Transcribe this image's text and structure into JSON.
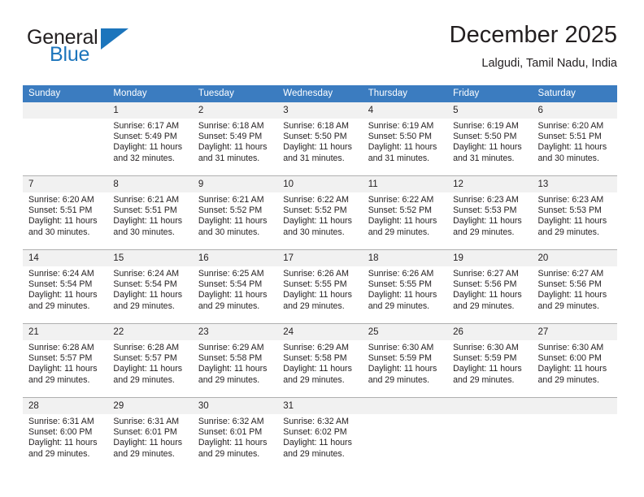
{
  "brand": {
    "name_part1": "General",
    "name_part2": "Blue",
    "flag_icon": "triangle-flag-icon"
  },
  "header": {
    "title": "December 2025",
    "subtitle": "Lalgudi, Tamil Nadu, India"
  },
  "colors": {
    "header_bar": "#3b7cc0",
    "brand_blue": "#1c75bc",
    "day_number_bg": "#f1f1f1",
    "row_divider": "#b0b0b0",
    "text": "#231f20"
  },
  "labels": {
    "sunrise_prefix": "Sunrise:",
    "sunset_prefix": "Sunset:",
    "daylight_prefix": "Daylight:"
  },
  "weekday_headers": [
    "Sunday",
    "Monday",
    "Tuesday",
    "Wednesday",
    "Thursday",
    "Friday",
    "Saturday"
  ],
  "weeks": [
    [
      {
        "day": "",
        "empty": true
      },
      {
        "day": "1",
        "sunrise": "Sunrise: 6:17 AM",
        "sunset": "Sunset: 5:49 PM",
        "daylight_line1": "Daylight: 11 hours",
        "daylight_line2": "and 32 minutes."
      },
      {
        "day": "2",
        "sunrise": "Sunrise: 6:18 AM",
        "sunset": "Sunset: 5:49 PM",
        "daylight_line1": "Daylight: 11 hours",
        "daylight_line2": "and 31 minutes."
      },
      {
        "day": "3",
        "sunrise": "Sunrise: 6:18 AM",
        "sunset": "Sunset: 5:50 PM",
        "daylight_line1": "Daylight: 11 hours",
        "daylight_line2": "and 31 minutes."
      },
      {
        "day": "4",
        "sunrise": "Sunrise: 6:19 AM",
        "sunset": "Sunset: 5:50 PM",
        "daylight_line1": "Daylight: 11 hours",
        "daylight_line2": "and 31 minutes."
      },
      {
        "day": "5",
        "sunrise": "Sunrise: 6:19 AM",
        "sunset": "Sunset: 5:50 PM",
        "daylight_line1": "Daylight: 11 hours",
        "daylight_line2": "and 31 minutes."
      },
      {
        "day": "6",
        "sunrise": "Sunrise: 6:20 AM",
        "sunset": "Sunset: 5:51 PM",
        "daylight_line1": "Daylight: 11 hours",
        "daylight_line2": "and 30 minutes."
      }
    ],
    [
      {
        "day": "7",
        "sunrise": "Sunrise: 6:20 AM",
        "sunset": "Sunset: 5:51 PM",
        "daylight_line1": "Daylight: 11 hours",
        "daylight_line2": "and 30 minutes."
      },
      {
        "day": "8",
        "sunrise": "Sunrise: 6:21 AM",
        "sunset": "Sunset: 5:51 PM",
        "daylight_line1": "Daylight: 11 hours",
        "daylight_line2": "and 30 minutes."
      },
      {
        "day": "9",
        "sunrise": "Sunrise: 6:21 AM",
        "sunset": "Sunset: 5:52 PM",
        "daylight_line1": "Daylight: 11 hours",
        "daylight_line2": "and 30 minutes."
      },
      {
        "day": "10",
        "sunrise": "Sunrise: 6:22 AM",
        "sunset": "Sunset: 5:52 PM",
        "daylight_line1": "Daylight: 11 hours",
        "daylight_line2": "and 30 minutes."
      },
      {
        "day": "11",
        "sunrise": "Sunrise: 6:22 AM",
        "sunset": "Sunset: 5:52 PM",
        "daylight_line1": "Daylight: 11 hours",
        "daylight_line2": "and 29 minutes."
      },
      {
        "day": "12",
        "sunrise": "Sunrise: 6:23 AM",
        "sunset": "Sunset: 5:53 PM",
        "daylight_line1": "Daylight: 11 hours",
        "daylight_line2": "and 29 minutes."
      },
      {
        "day": "13",
        "sunrise": "Sunrise: 6:23 AM",
        "sunset": "Sunset: 5:53 PM",
        "daylight_line1": "Daylight: 11 hours",
        "daylight_line2": "and 29 minutes."
      }
    ],
    [
      {
        "day": "14",
        "sunrise": "Sunrise: 6:24 AM",
        "sunset": "Sunset: 5:54 PM",
        "daylight_line1": "Daylight: 11 hours",
        "daylight_line2": "and 29 minutes."
      },
      {
        "day": "15",
        "sunrise": "Sunrise: 6:24 AM",
        "sunset": "Sunset: 5:54 PM",
        "daylight_line1": "Daylight: 11 hours",
        "daylight_line2": "and 29 minutes."
      },
      {
        "day": "16",
        "sunrise": "Sunrise: 6:25 AM",
        "sunset": "Sunset: 5:54 PM",
        "daylight_line1": "Daylight: 11 hours",
        "daylight_line2": "and 29 minutes."
      },
      {
        "day": "17",
        "sunrise": "Sunrise: 6:26 AM",
        "sunset": "Sunset: 5:55 PM",
        "daylight_line1": "Daylight: 11 hours",
        "daylight_line2": "and 29 minutes."
      },
      {
        "day": "18",
        "sunrise": "Sunrise: 6:26 AM",
        "sunset": "Sunset: 5:55 PM",
        "daylight_line1": "Daylight: 11 hours",
        "daylight_line2": "and 29 minutes."
      },
      {
        "day": "19",
        "sunrise": "Sunrise: 6:27 AM",
        "sunset": "Sunset: 5:56 PM",
        "daylight_line1": "Daylight: 11 hours",
        "daylight_line2": "and 29 minutes."
      },
      {
        "day": "20",
        "sunrise": "Sunrise: 6:27 AM",
        "sunset": "Sunset: 5:56 PM",
        "daylight_line1": "Daylight: 11 hours",
        "daylight_line2": "and 29 minutes."
      }
    ],
    [
      {
        "day": "21",
        "sunrise": "Sunrise: 6:28 AM",
        "sunset": "Sunset: 5:57 PM",
        "daylight_line1": "Daylight: 11 hours",
        "daylight_line2": "and 29 minutes."
      },
      {
        "day": "22",
        "sunrise": "Sunrise: 6:28 AM",
        "sunset": "Sunset: 5:57 PM",
        "daylight_line1": "Daylight: 11 hours",
        "daylight_line2": "and 29 minutes."
      },
      {
        "day": "23",
        "sunrise": "Sunrise: 6:29 AM",
        "sunset": "Sunset: 5:58 PM",
        "daylight_line1": "Daylight: 11 hours",
        "daylight_line2": "and 29 minutes."
      },
      {
        "day": "24",
        "sunrise": "Sunrise: 6:29 AM",
        "sunset": "Sunset: 5:58 PM",
        "daylight_line1": "Daylight: 11 hours",
        "daylight_line2": "and 29 minutes."
      },
      {
        "day": "25",
        "sunrise": "Sunrise: 6:30 AM",
        "sunset": "Sunset: 5:59 PM",
        "daylight_line1": "Daylight: 11 hours",
        "daylight_line2": "and 29 minutes."
      },
      {
        "day": "26",
        "sunrise": "Sunrise: 6:30 AM",
        "sunset": "Sunset: 5:59 PM",
        "daylight_line1": "Daylight: 11 hours",
        "daylight_line2": "and 29 minutes."
      },
      {
        "day": "27",
        "sunrise": "Sunrise: 6:30 AM",
        "sunset": "Sunset: 6:00 PM",
        "daylight_line1": "Daylight: 11 hours",
        "daylight_line2": "and 29 minutes."
      }
    ],
    [
      {
        "day": "28",
        "sunrise": "Sunrise: 6:31 AM",
        "sunset": "Sunset: 6:00 PM",
        "daylight_line1": "Daylight: 11 hours",
        "daylight_line2": "and 29 minutes."
      },
      {
        "day": "29",
        "sunrise": "Sunrise: 6:31 AM",
        "sunset": "Sunset: 6:01 PM",
        "daylight_line1": "Daylight: 11 hours",
        "daylight_line2": "and 29 minutes."
      },
      {
        "day": "30",
        "sunrise": "Sunrise: 6:32 AM",
        "sunset": "Sunset: 6:01 PM",
        "daylight_line1": "Daylight: 11 hours",
        "daylight_line2": "and 29 minutes."
      },
      {
        "day": "31",
        "sunrise": "Sunrise: 6:32 AM",
        "sunset": "Sunset: 6:02 PM",
        "daylight_line1": "Daylight: 11 hours",
        "daylight_line2": "and 29 minutes."
      },
      {
        "day": "",
        "empty": true
      },
      {
        "day": "",
        "empty": true
      },
      {
        "day": "",
        "empty": true
      }
    ]
  ]
}
